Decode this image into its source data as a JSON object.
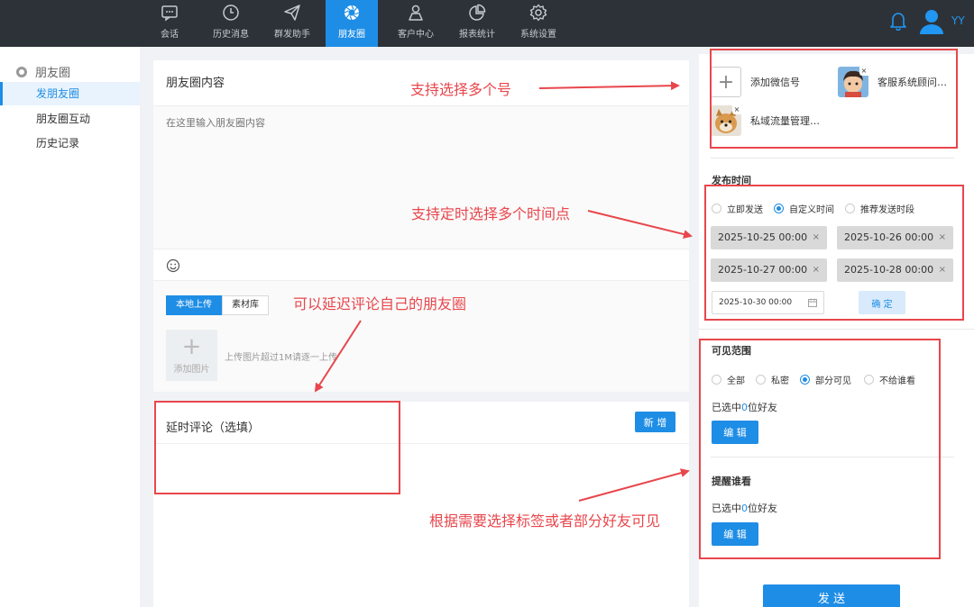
{
  "nav": {
    "items": [
      {
        "label": "会话",
        "icon": "chat-icon"
      },
      {
        "label": "历史消息",
        "icon": "clock-icon"
      },
      {
        "label": "群发助手",
        "icon": "send-icon"
      },
      {
        "label": "朋友圈",
        "icon": "moments-icon",
        "active": true
      },
      {
        "label": "客户中心",
        "icon": "person-icon"
      },
      {
        "label": "报表统计",
        "icon": "pie-chart-icon"
      },
      {
        "label": "系统设置",
        "icon": "gear-icon"
      }
    ],
    "user_name": "YY"
  },
  "sidebar": {
    "header": "朋友圈",
    "items": [
      {
        "label": "发朋友圈",
        "active": true
      },
      {
        "label": "朋友圈互动"
      },
      {
        "label": "历史记录"
      }
    ]
  },
  "editor": {
    "title": "朋友圈内容",
    "placeholder": "在这里输入朋友圈内容",
    "tabs": [
      "本地上传",
      "素材库"
    ],
    "add_image_label": "添加图片",
    "upload_hint": "上传图片超过1M请逐一上传"
  },
  "delay_comment": {
    "title": "延时评论（选填）",
    "add_button": "新 增"
  },
  "accounts": {
    "add_label": "添加微信号",
    "list": [
      {
        "name": "客服系统顾问…"
      },
      {
        "name": "私域流量管理…"
      }
    ]
  },
  "publish_time": {
    "title": "发布时间",
    "options": [
      "立即发送",
      "自定义时间",
      "推荐发送时段"
    ],
    "selected": "自定义时间",
    "times": [
      "2025-10-25 00:00",
      "2025-10-26 00:00",
      "2025-10-27 00:00",
      "2025-10-28 00:00"
    ],
    "date_input": "2025-10-30 00:00",
    "confirm": "确 定"
  },
  "visibility": {
    "title": "可见范围",
    "options": [
      "全部",
      "私密",
      "部分可见",
      "不给谁看"
    ],
    "selected": "部分可见",
    "selected_prefix": "已选中",
    "selected_count": "0",
    "selected_suffix": "位好友",
    "edit_button": "编 辑"
  },
  "remind": {
    "title": "提醒谁看",
    "selected_prefix": "已选中",
    "selected_count": "0",
    "selected_suffix": "位好友",
    "edit_button": "编 辑"
  },
  "send_button": "发 送",
  "annotations": {
    "multi_account": "支持选择多个号",
    "multi_time": "支持定时选择多个时间点",
    "delay_comment": "可以延迟评论自己的朋友圈",
    "visibility": "根据需要选择标签或者部分好友可见"
  },
  "colors": {
    "accent": "#1e8de5",
    "topbar": "#2d3238",
    "annotation": "#e8464c"
  }
}
